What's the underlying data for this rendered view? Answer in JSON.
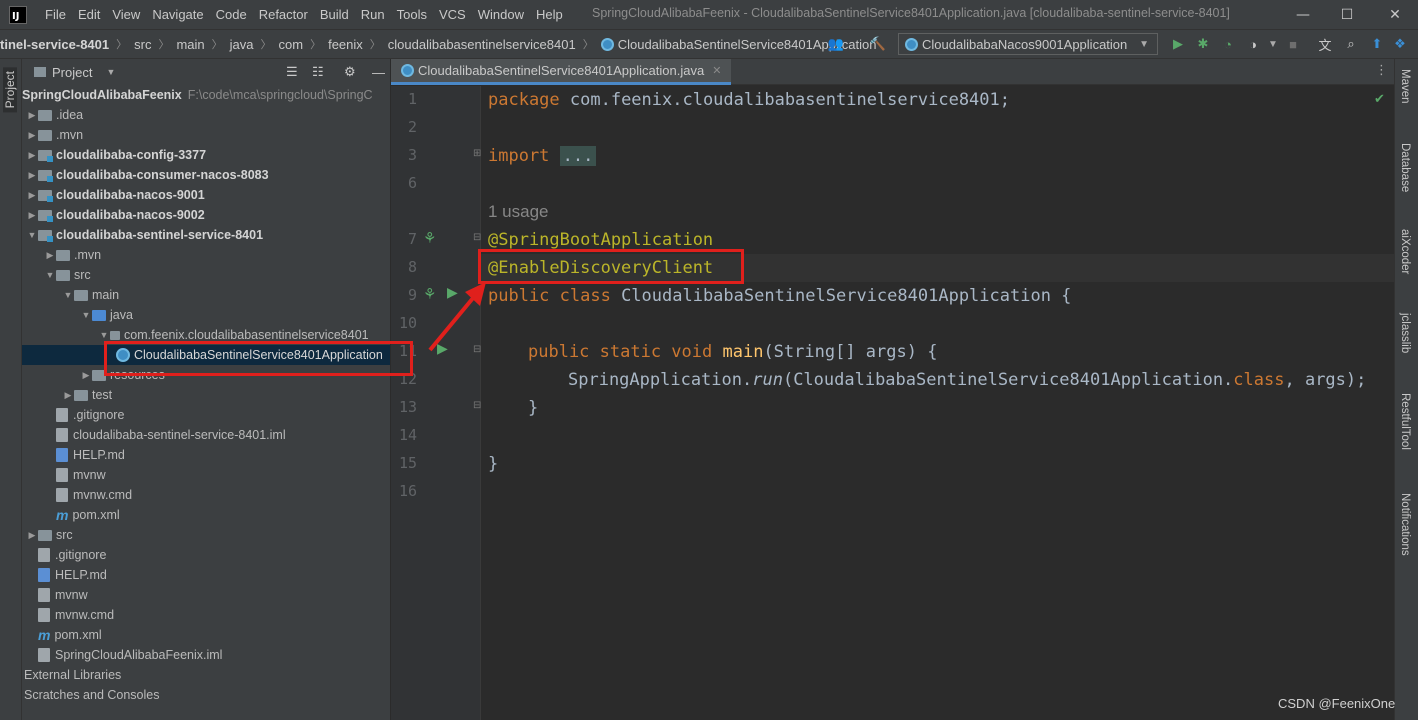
{
  "titlebar": {
    "logo_text": "IJ",
    "window_title": "SpringCloudAlibabaFeenix - CloudalibabaSentinelService8401Application.java [cloudalibaba-sentinel-service-8401]",
    "menu": [
      "File",
      "Edit",
      "View",
      "Navigate",
      "Code",
      "Refactor",
      "Build",
      "Run",
      "Tools",
      "VCS",
      "Window",
      "Help"
    ],
    "minimize": "—",
    "maximize": "☐",
    "close": "✕"
  },
  "navbar": {
    "breadcrumbs": [
      "tinel-service-8401",
      "src",
      "main",
      "java",
      "com",
      "feenix",
      "cloudalibabasentinelservice8401",
      "CloudalibabaSentinelService8401Application"
    ],
    "run_config": "CloudalibabaNacos9001Application"
  },
  "left_stripe": {
    "label": "Project"
  },
  "project": {
    "header": "Project",
    "tree": [
      {
        "text": "SpringCloudAlibabaFeenix",
        "extra": "F:\\code\\mca\\springcloud\\SpringC"
      },
      {
        "text": ".idea"
      },
      {
        "text": ".mvn"
      },
      {
        "text": "cloudalibaba-config-3377"
      },
      {
        "text": "cloudalibaba-consumer-nacos-8083"
      },
      {
        "text": "cloudalibaba-nacos-9001"
      },
      {
        "text": "cloudalibaba-nacos-9002"
      },
      {
        "text": "cloudalibaba-sentinel-service-8401"
      },
      {
        "text": ".mvn"
      },
      {
        "text": "src"
      },
      {
        "text": "main"
      },
      {
        "text": "java"
      },
      {
        "text": "com.feenix.cloudalibabasentinelservice8401"
      },
      {
        "text": "CloudalibabaSentinelService8401Application"
      },
      {
        "text": "resources"
      },
      {
        "text": "test"
      },
      {
        "text": ".gitignore"
      },
      {
        "text": "cloudalibaba-sentinel-service-8401.iml"
      },
      {
        "text": "HELP.md"
      },
      {
        "text": "mvnw"
      },
      {
        "text": "mvnw.cmd"
      },
      {
        "text": "pom.xml"
      },
      {
        "text": "src"
      },
      {
        "text": ".gitignore"
      },
      {
        "text": "HELP.md"
      },
      {
        "text": "mvnw"
      },
      {
        "text": "mvnw.cmd"
      },
      {
        "text": "pom.xml"
      },
      {
        "text": "SpringCloudAlibabaFeenix.iml"
      },
      {
        "text": "External Libraries"
      },
      {
        "text": "Scratches and Consoles"
      }
    ]
  },
  "editor": {
    "tab_label": "CloudalibabaSentinelService8401Application.java",
    "line_numbers": [
      "1",
      "2",
      "3",
      "6",
      "7",
      "8",
      "9",
      "10",
      "11",
      "12",
      "13",
      "14",
      "15",
      "16"
    ],
    "code": {
      "l1_kw": "package",
      "l1_rest": " com.feenix.cloudalibabasentinelservice8401;",
      "l3_kw": "import",
      "l3_fold": "...",
      "usage": "1 usage",
      "l7": "@SpringBootApplication",
      "l8": "@EnableDiscoveryClient",
      "l9_kw": "public class",
      "l9_rest": " CloudalibabaSentinelService8401Application {",
      "l11_kw": "public static void",
      "l11_fn": "main",
      "l11_rest": "(String[] args) {",
      "l12_a": "SpringApplication.",
      "l12_run": "run",
      "l12_b": "(CloudalibabaSentinelService8401Application.",
      "l12_kw": "class",
      "l12_c": ", args);",
      "l13": "}",
      "l15": "}"
    }
  },
  "right_stripe": [
    "Maven",
    "Database",
    "aiXcoder",
    "jclasslib",
    "RestfulTool",
    "Notifications"
  ],
  "watermark": "CSDN @FeenixOne",
  "colors": {
    "accent": "#4a88c7",
    "highlight_box": "#e0201c",
    "annotation": "#bbb529",
    "keyword": "#cc7832"
  }
}
